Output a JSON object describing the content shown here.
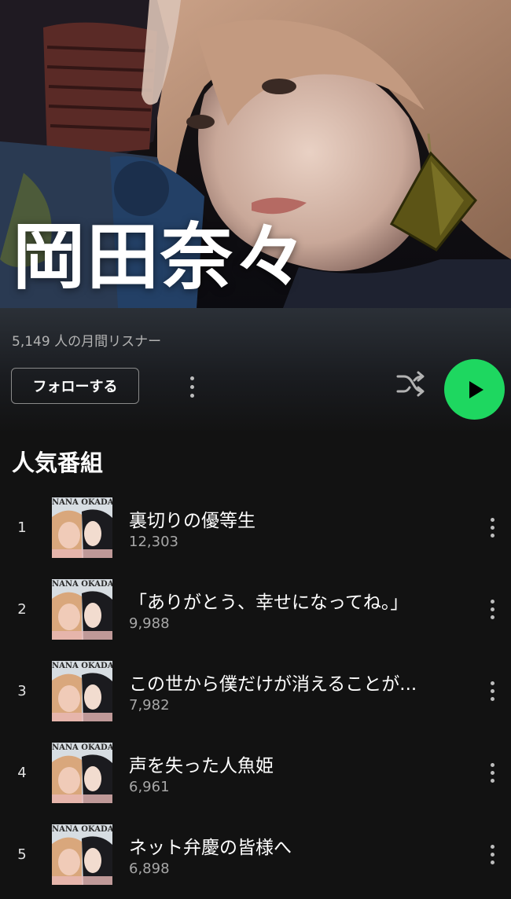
{
  "artist": {
    "name": "岡田奈々",
    "monthly_listeners": "5,149 人の月間リスナー"
  },
  "actions": {
    "follow_label": "フォローする",
    "more_icon": "more-vert-icon",
    "shuffle_icon": "shuffle-icon",
    "play_icon": "play-icon"
  },
  "popular": {
    "title": "人気番組",
    "cover_text": "NANA OKADA",
    "tracks": [
      {
        "rank": "1",
        "title": "裏切りの優等生",
        "plays": "12,303"
      },
      {
        "rank": "2",
        "title": "「ありがとう、幸せになってね。」",
        "plays": "9,988"
      },
      {
        "rank": "3",
        "title": "この世から僕だけが消えることが...",
        "plays": "7,982"
      },
      {
        "rank": "4",
        "title": "声を失った人魚姫",
        "plays": "6,961"
      },
      {
        "rank": "5",
        "title": "ネット弁慶の皆様へ",
        "plays": "6,898"
      }
    ]
  },
  "colors": {
    "background": "#121212",
    "accent_green": "#1ed760",
    "secondary_text": "#b3b3b3"
  }
}
